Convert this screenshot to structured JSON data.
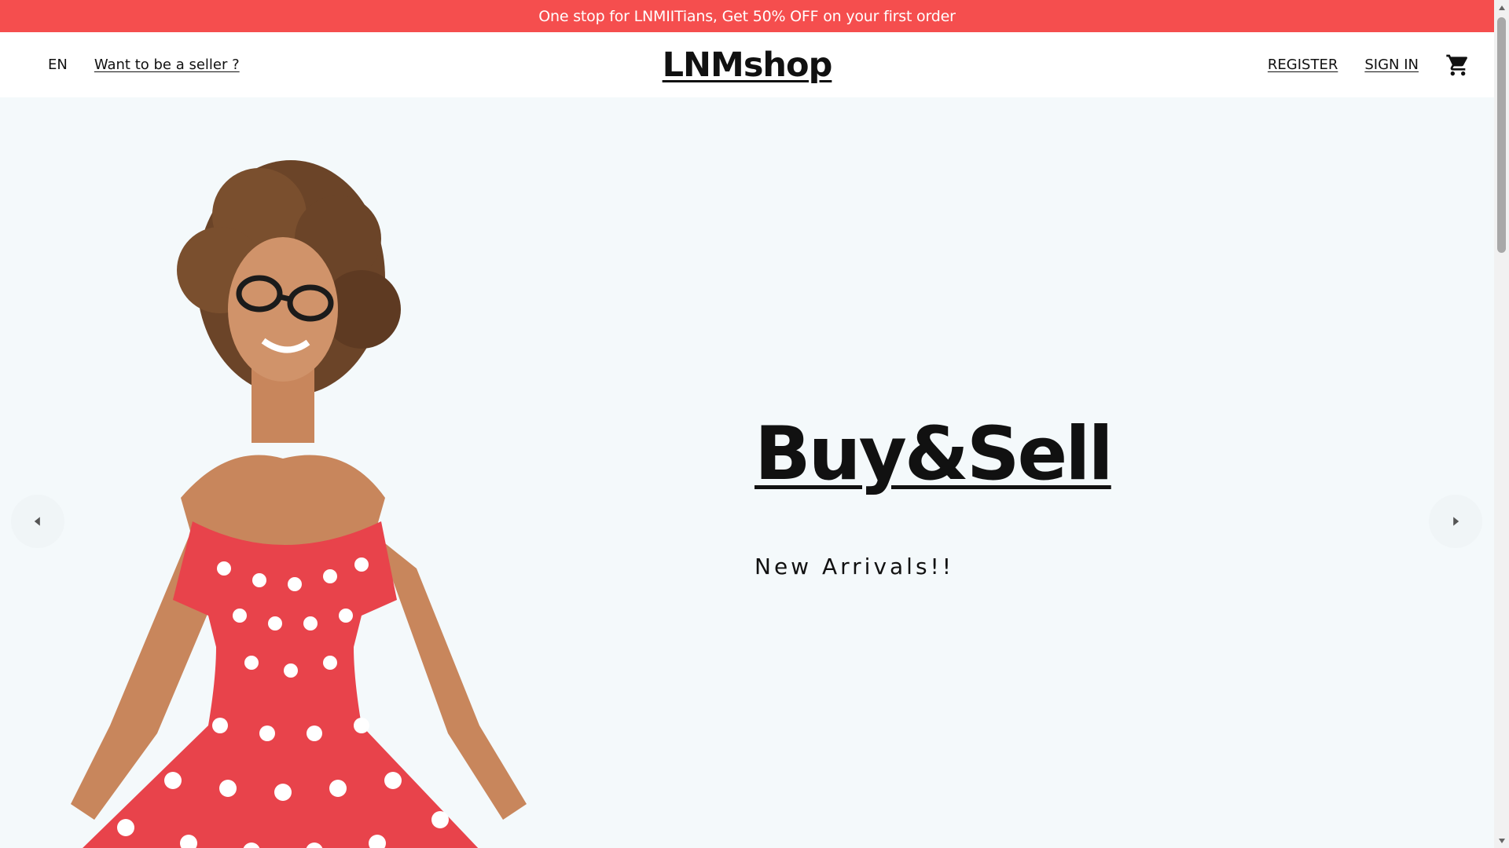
{
  "announcement": {
    "text": "One stop for LNMIITians, Get 50% OFF on your first order",
    "background": "#f54e4e"
  },
  "nav": {
    "language": "EN",
    "seller_link": "Want to be a seller ?",
    "logo": "LNMshop",
    "register": "REGISTER",
    "sign_in": "SIGN IN",
    "cart_icon": "cart-icon"
  },
  "hero": {
    "title": "Buy&Sell",
    "subtitle": "New Arrivals!!",
    "background": "#f4f9fb",
    "prev_icon": "arrow-left-icon",
    "next_icon": "arrow-right-icon"
  }
}
